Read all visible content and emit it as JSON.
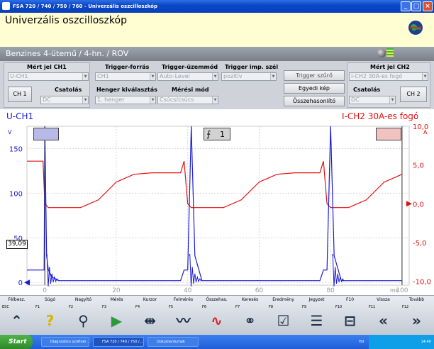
{
  "window": {
    "title": "FSA 720 / 740 / 750 / 760 - Univerzális oszcilloszkóp"
  },
  "header": {
    "title": "Univerzális oszcilloszkóp",
    "band": "Benzines 4-ütemű / 4-hn. / ROV"
  },
  "ch1": {
    "heading": "Mért jel CH1",
    "value": "U-CH1",
    "button": "CH 1",
    "coupling_label": "Csatolás",
    "coupling": "DC"
  },
  "trigger": {
    "source_label": "Trigger-forrás",
    "source": "CH1",
    "mode_label": "Trigger-üzemmód",
    "mode": "Auto-Level",
    "edge_label": "Trigger imp. szél",
    "edge": "pozitív",
    "cyl_label": "Henger kiválasztás",
    "cyl": "1. henger",
    "meas_label": "Mérési mód",
    "meas": "Csúcs/csúcs"
  },
  "buttons": {
    "filter": "Trigger szűrő",
    "single": "Egyedi kép",
    "compare": "Összehasonlító"
  },
  "ch2": {
    "heading": "Mért jel CH2",
    "value": "I-CH2 30A-es fogó",
    "button": "CH 2",
    "coupling_label": "Csatolás",
    "coupling": "DC"
  },
  "scope": {
    "ch1_name": "U-CH1",
    "ch2_name": "I-CH2 30A-es fogó",
    "left_unit": "V",
    "right_unit": "A",
    "x_unit": "ms",
    "left_ticks": [
      "150",
      "100",
      "50",
      "0"
    ],
    "right_ticks": [
      "10,0",
      "5,0",
      "0,0",
      "-5,0",
      "-10,0"
    ],
    "x_ticks": [
      "0",
      "20",
      "40",
      "60",
      "80",
      "100"
    ],
    "cursor_value": "39,09",
    "trigger_marker": "1"
  },
  "chart_data": {
    "type": "line",
    "xlabel": "ms",
    "xlim": [
      -5,
      102
    ],
    "series": [
      {
        "name": "U-CH1",
        "axis": "left",
        "unit": "V",
        "ylim": [
          -3,
          175
        ],
        "x": [
          -5,
          -0.2,
          0,
          0.5,
          1,
          2,
          4,
          5,
          6,
          8,
          20,
          25,
          33,
          38,
          39,
          40,
          41,
          42,
          44,
          45,
          46,
          48,
          60,
          65,
          72,
          77,
          78,
          79,
          80,
          81,
          83,
          84,
          85,
          87,
          100
        ],
        "y": [
          14,
          14,
          175,
          30,
          14,
          6,
          2,
          2,
          2,
          2,
          2,
          2,
          2,
          2,
          14,
          14,
          175,
          30,
          2,
          2,
          2,
          2,
          2,
          2,
          2,
          2,
          14,
          14,
          175,
          30,
          2,
          2,
          2,
          2,
          2
        ]
      },
      {
        "name": "I-CH2 30A-es fogó",
        "axis": "right",
        "unit": "A",
        "ylim": [
          -10.5,
          10
        ],
        "x": [
          -5,
          -0.5,
          0,
          1,
          5,
          10,
          15,
          20,
          25,
          30,
          34,
          38,
          39,
          40,
          41,
          45,
          50,
          55,
          60,
          65,
          70,
          73,
          77,
          78,
          79,
          80,
          85,
          90,
          95,
          100
        ],
        "y": [
          5.5,
          5.5,
          0,
          -0.5,
          -0.5,
          -0.5,
          0.5,
          2.8,
          3.8,
          4,
          4,
          4,
          5.5,
          0,
          -0.5,
          -0.5,
          -0.5,
          0.5,
          2.8,
          3.8,
          4,
          4,
          4,
          5.5,
          0,
          -0.5,
          -0.5,
          0.5,
          2.8,
          3.8
        ]
      }
    ]
  },
  "fkeys": [
    {
      "name": "Félbesz.",
      "key": "ESC",
      "icon": "double-chevron-up-icon"
    },
    {
      "name": "Súgó",
      "key": "F1",
      "icon": "question-mark-icon"
    },
    {
      "name": "Nagyító",
      "key": "F2",
      "icon": "magnifier-icon"
    },
    {
      "name": "Mérés",
      "key": "F3",
      "icon": "play-icon"
    },
    {
      "name": "Kurzor",
      "key": "F4",
      "icon": "cursor-waveform-icon"
    },
    {
      "name": "Felmérés",
      "key": "F5",
      "icon": "survey-waveform-icon"
    },
    {
      "name": "Összehas.",
      "key": "F6",
      "icon": "compare-curve-icon"
    },
    {
      "name": "Keresés",
      "key": "F7",
      "icon": "binoculars-icon"
    },
    {
      "name": "Eredmény",
      "key": "F8",
      "icon": "result-document-icon"
    },
    {
      "name": "Jegyzet",
      "key": "F9",
      "icon": "note-document-icon"
    },
    {
      "name": "F10",
      "key": "F10",
      "icon": "network-icon"
    },
    {
      "name": "Vissza",
      "key": "F11",
      "icon": "double-chevron-left-icon"
    },
    {
      "name": "Tovább",
      "key": "F12",
      "icon": "double-chevron-right-icon"
    }
  ],
  "taskbar": {
    "start": "Start",
    "items": [
      "Diagnostics szoftver ...",
      "FSA 720 / 740 / 750 /...",
      "Dokumentumok"
    ],
    "lang": "HU",
    "clock": "14:40"
  },
  "colors": {
    "ch1": "#1a1ad6",
    "ch2": "#e01010",
    "header": "#fffed2",
    "panel": "#cfd3d9"
  }
}
